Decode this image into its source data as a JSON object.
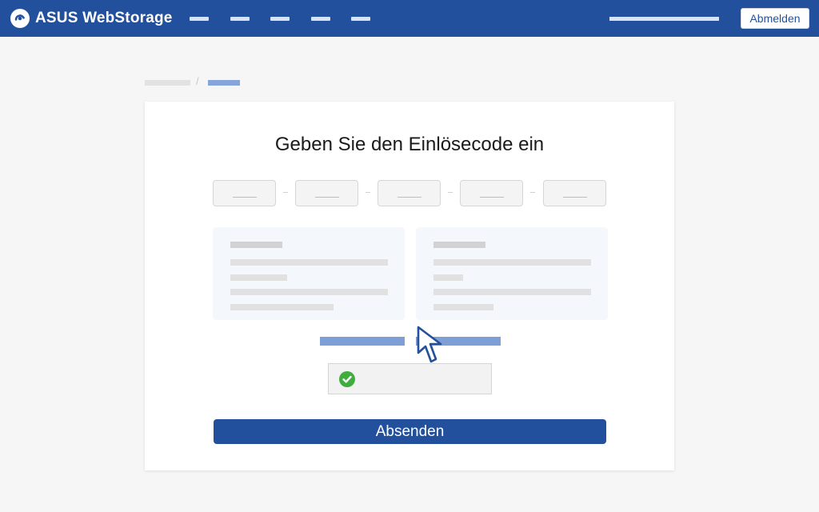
{
  "header": {
    "brand": "ASUS WebStorage",
    "logo_icon": "webstorage-cloud-logo-icon",
    "logout_label": "Abmelden",
    "nav_item_count": 5
  },
  "breadcrumb": {
    "separator": "/"
  },
  "main": {
    "title": "Geben Sie den Einlösecode ein",
    "code_field_count": 5,
    "submit_label": "Absenden",
    "captcha": {
      "checked": true,
      "check_icon": "checkmark-icon"
    }
  },
  "colors": {
    "brand_blue": "#23509d",
    "link_blue": "#7e9fd6",
    "success_green": "#3fae3f",
    "page_background": "#f6f6f6"
  }
}
